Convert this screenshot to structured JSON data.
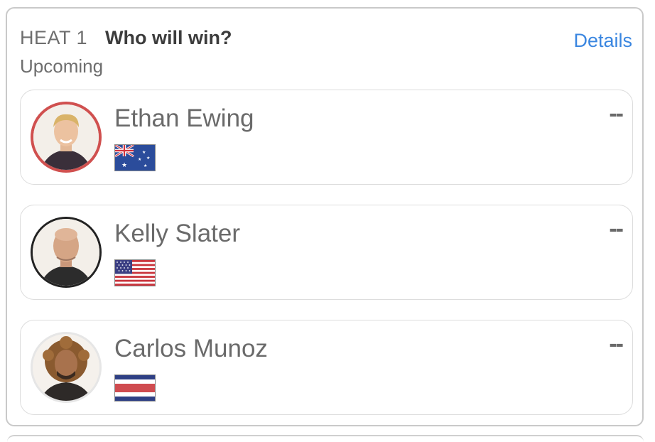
{
  "heat": {
    "label": "HEAT 1",
    "question": "Who will win?",
    "status": "Upcoming",
    "details_label": "Details"
  },
  "surfers": [
    {
      "name": "Ethan Ewing",
      "score": "--",
      "flag": "australia-flag",
      "ring_color": "#d0504f"
    },
    {
      "name": "Kelly Slater",
      "score": "--",
      "flag": "usa-flag",
      "ring_color": "#222222"
    },
    {
      "name": "Carlos Munoz",
      "score": "--",
      "flag": "costa-rica-flag",
      "ring_color": "#e6e6e6"
    }
  ]
}
